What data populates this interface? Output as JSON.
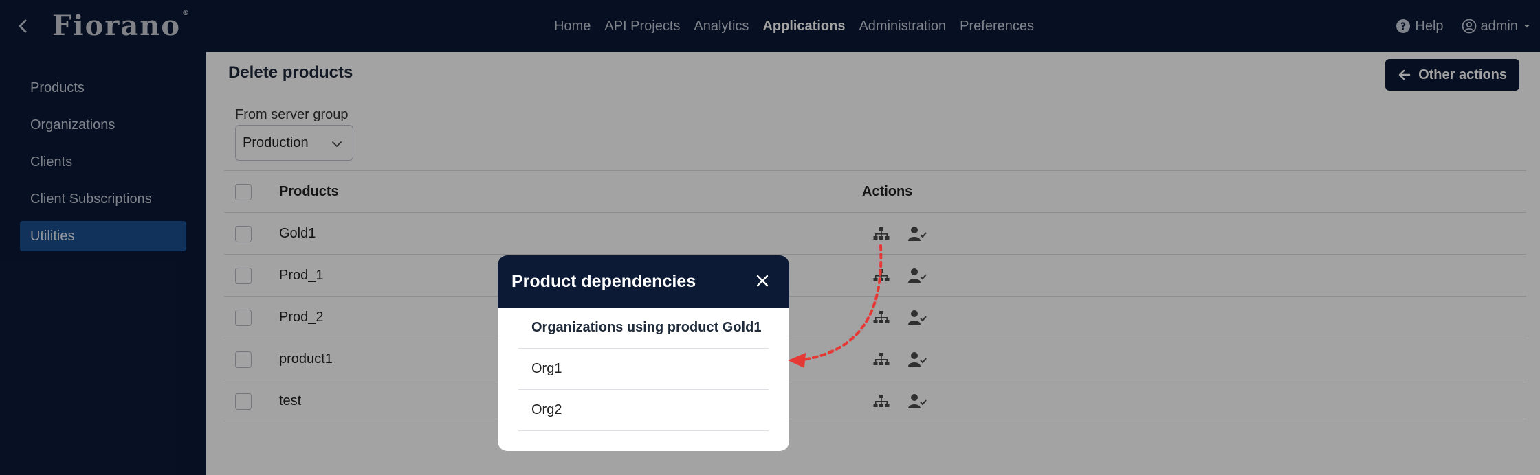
{
  "topbar": {
    "logo_text": "Fiorano",
    "logo_mark": "®",
    "nav": [
      "Home",
      "API Projects",
      "Analytics",
      "Applications",
      "Administration",
      "Preferences"
    ],
    "active_nav": "Applications",
    "help_label": "Help",
    "user_label": "admin"
  },
  "sidebar": {
    "items": [
      "Products",
      "Organizations",
      "Clients",
      "Client Subscriptions",
      "Utilities"
    ],
    "active": "Utilities"
  },
  "main": {
    "title": "Delete products",
    "other_actions_label": "Other actions",
    "server_group_label": "From server group",
    "server_group_value": "Production",
    "table": {
      "headers": {
        "products": "Products",
        "actions": "Actions"
      },
      "rows": [
        "Gold1",
        "Prod_1",
        "Prod_2",
        "product1",
        "test"
      ]
    }
  },
  "modal": {
    "title": "Product dependencies",
    "section_header": "Organizations using product Gold1",
    "organizations": [
      "Org1",
      "Org2"
    ]
  },
  "colors": {
    "navy": "#0c1a36",
    "active_blue": "#1b4f8f",
    "annotation_red": "#e53935"
  },
  "icons": {
    "back": "chevron-left-icon",
    "help": "question-circle-icon",
    "user": "user-circle-icon",
    "dependencies": "sitemap-icon",
    "subscribers": "user-check-icon",
    "close": "close-icon",
    "arrow_left": "arrow-left-icon",
    "dropdown": "chevron-down-icon"
  }
}
